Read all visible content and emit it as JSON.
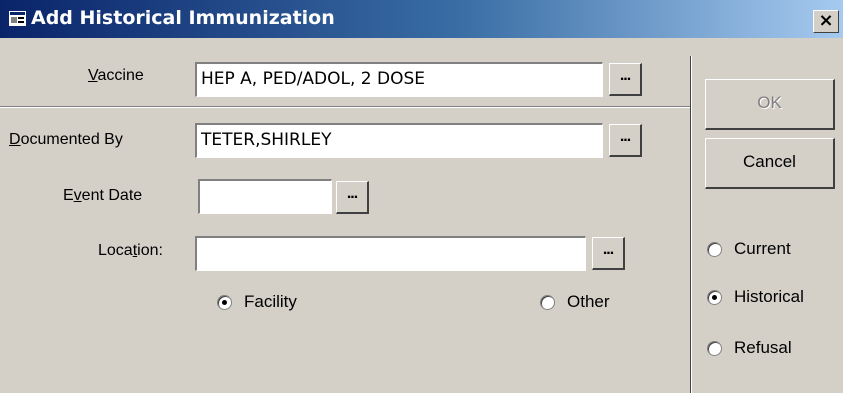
{
  "window": {
    "title": "Add Historical Immunization",
    "close_label": "×"
  },
  "form": {
    "vaccine": {
      "label_pre": "",
      "label_key": "V",
      "label_post": "accine",
      "value": "HEP A, PED/ADOL, 2 DOSE"
    },
    "documented_by": {
      "label_pre": "",
      "label_key": "D",
      "label_post": "ocumented By",
      "value": "TETER,SHIRLEY"
    },
    "event_date": {
      "label_pre": "E",
      "label_key": "v",
      "label_post": "ent Date",
      "value": ""
    },
    "location": {
      "label_pre": "Loca",
      "label_key": "t",
      "label_post": "ion:",
      "value": ""
    },
    "ellipsis": "...",
    "location_type": {
      "facility_label": "Facility",
      "other_label": "Other",
      "selected": "Facility"
    }
  },
  "actions": {
    "ok_label": "OK",
    "cancel_label": "Cancel",
    "ok_enabled": false
  },
  "status": {
    "options": [
      "Current",
      "Historical",
      "Refusal"
    ],
    "selected": "Historical"
  },
  "colors": {
    "titlebar_start": "#0a246a",
    "titlebar_end": "#a6caf0",
    "face": "#d4d0c8"
  }
}
